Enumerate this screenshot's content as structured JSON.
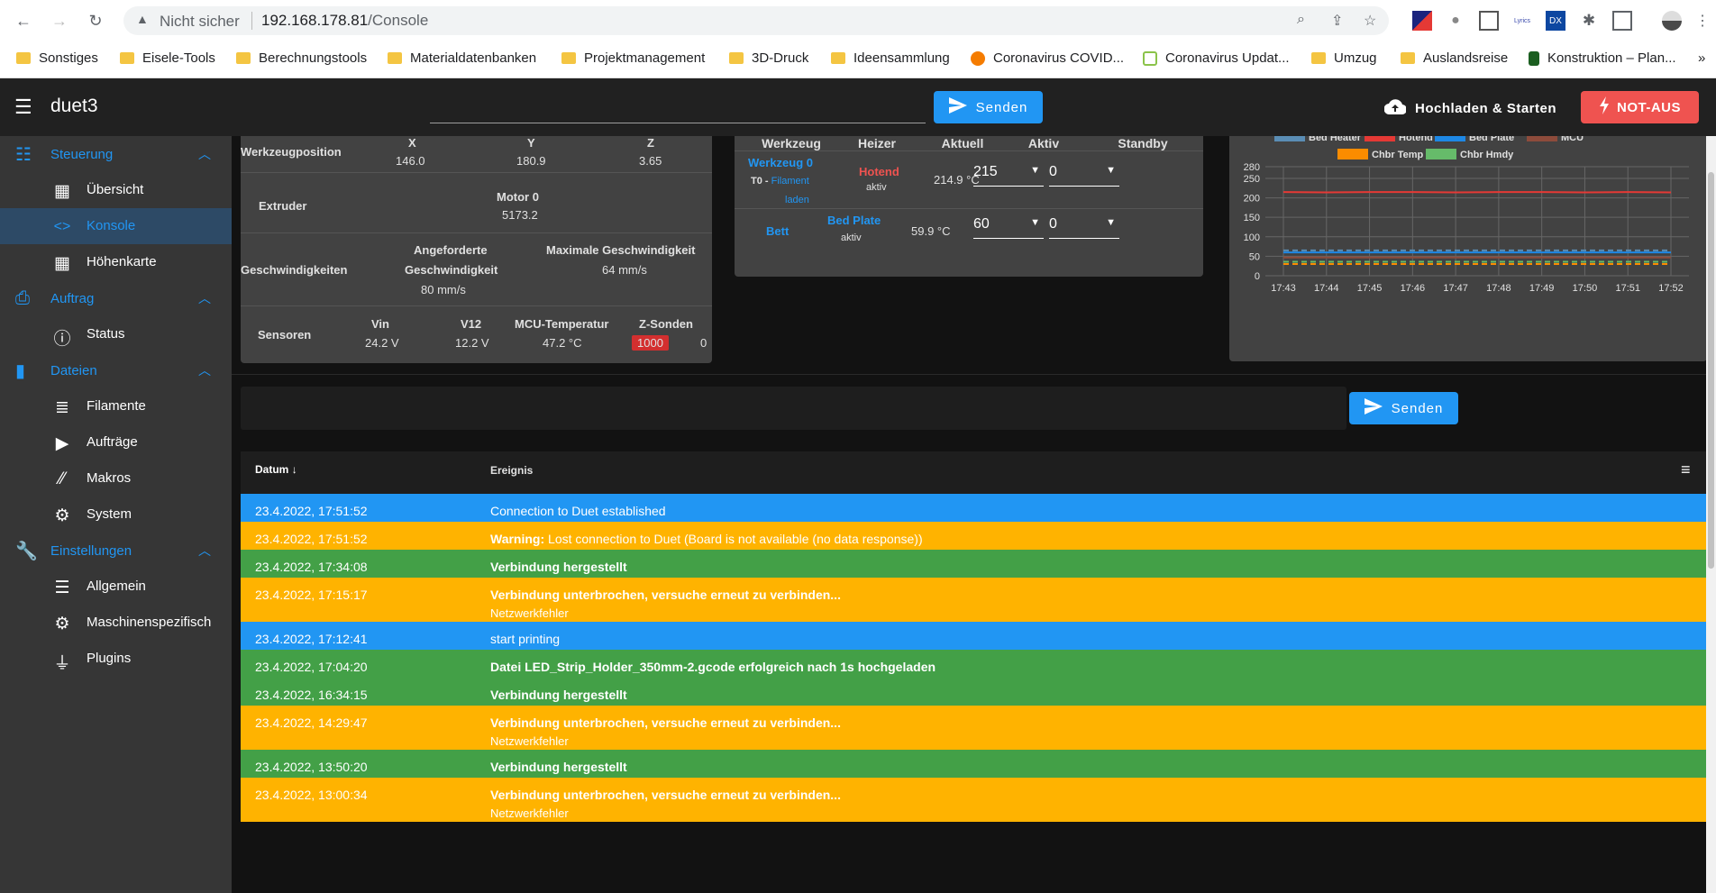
{
  "browser": {
    "security_label": "Nicht sicher",
    "url_host": "192.168.178.81",
    "url_path": "/Console",
    "bookmarks": [
      {
        "label": "Sonstiges",
        "kind": "folder"
      },
      {
        "label": "Eisele-Tools",
        "kind": "folder"
      },
      {
        "label": "Berechnungstools",
        "kind": "folder"
      },
      {
        "label": "Materialdatenbanken",
        "kind": "folder"
      },
      {
        "label": "Projektmanagement",
        "kind": "folder"
      },
      {
        "label": "3D-Druck",
        "kind": "folder"
      },
      {
        "label": "Ideensammlung",
        "kind": "folder"
      },
      {
        "label": "Coronavirus COVID...",
        "kind": "site"
      },
      {
        "label": "Coronavirus Updat...",
        "kind": "site"
      },
      {
        "label": "Umzug",
        "kind": "folder"
      },
      {
        "label": "Auslandsreise",
        "kind": "folder"
      },
      {
        "label": "Konstruktion – Plan...",
        "kind": "site"
      }
    ],
    "bookmarks_more": "»"
  },
  "app": {
    "title": "duet3",
    "send_label": "Senden",
    "upload_label": "Hochladen & Starten",
    "estop_label": "NOT-AUS"
  },
  "sidebar": {
    "groups": [
      {
        "label": "Steuerung",
        "icon": "sliders-icon",
        "items": [
          {
            "label": "Übersicht",
            "icon": "dashboard-icon",
            "active": false
          },
          {
            "label": "Konsole",
            "icon": "code-icon",
            "active": true
          },
          {
            "label": "Höhenkarte",
            "icon": "grid-icon",
            "active": false
          }
        ]
      },
      {
        "label": "Auftrag",
        "icon": "printer-icon",
        "items": [
          {
            "label": "Status",
            "icon": "info-icon",
            "active": false
          }
        ]
      },
      {
        "label": "Dateien",
        "icon": "sd-card-icon",
        "items": [
          {
            "label": "Filamente",
            "icon": "database-icon",
            "active": false
          },
          {
            "label": "Aufträge",
            "icon": "play-icon",
            "active": false
          },
          {
            "label": "Makros",
            "icon": "macro-icon",
            "active": false
          },
          {
            "label": "System",
            "icon": "gear-icon",
            "active": false
          }
        ]
      },
      {
        "label": "Einstellungen",
        "icon": "wrench-icon",
        "items": [
          {
            "label": "Allgemein",
            "icon": "tune-icon",
            "active": false
          },
          {
            "label": "Maschinenspezifisch",
            "icon": "cogs-icon",
            "active": false
          },
          {
            "label": "Plugins",
            "icon": "plug-icon",
            "active": false
          }
        ]
      }
    ]
  },
  "status": {
    "tool_position_label": "Werkzeugposition",
    "axes": [
      {
        "name": "X",
        "value": "146.0"
      },
      {
        "name": "Y",
        "value": "180.9"
      },
      {
        "name": "Z",
        "value": "3.65"
      }
    ],
    "extruder_label": "Extruder",
    "motor_label": "Motor 0",
    "motor_value": "5173.2",
    "speeds_label": "Geschwindigkeiten",
    "req_speed_label_1": "Angeforderte",
    "req_speed_label_2": "Geschwindigkeit",
    "req_speed_value": "80 mm/s",
    "max_speed_label": "Maximale Geschwindigkeit",
    "max_speed_value": "64 mm/s",
    "sensors_label": "Sensoren",
    "vin_label": "Vin",
    "vin_value": "24.2 V",
    "v12_label": "V12",
    "v12_value": "12.2 V",
    "mcu_label": "MCU-Temperatur",
    "mcu_value": "47.2 °C",
    "zprobe_label": "Z-Sonden",
    "zprobe_value_1": "1000",
    "zprobe_value_2": "0"
  },
  "tools": {
    "headers": [
      "Werkzeug",
      "Heizer",
      "Aktuell",
      "Aktiv",
      "Standby"
    ],
    "tool_name": "Werkzeug 0",
    "tool_sub_prefix": "T0 - ",
    "tool_sub_link_1": "Filament",
    "tool_sub_link_2": "laden",
    "heater_1_name": "Hotend",
    "heater_1_state": "aktiv",
    "heater_1_current": "214.9 °C",
    "heater_1_active": "215",
    "heater_1_standby": "0",
    "bed_label": "Bett",
    "heater_2_name": "Bed Plate",
    "heater_2_state": "aktiv",
    "heater_2_current": "59.9 °C",
    "heater_2_active": "60",
    "heater_2_standby": "0"
  },
  "colors": {
    "accent": "#2196f3",
    "warning": "#ffb300",
    "success": "#43a047",
    "danger": "#ef5350"
  },
  "chart_data": {
    "type": "line",
    "legend_row1": [
      "Bed Heater",
      "Hotend",
      "Bed Plate",
      "MCU"
    ],
    "legend_row2": [
      "Chbr Temp",
      "Chbr Hmdy"
    ],
    "x": [
      "17:43",
      "17:44",
      "17:45",
      "17:46",
      "17:47",
      "17:48",
      "17:49",
      "17:50",
      "17:51",
      "17:52"
    ],
    "yticks": [
      0,
      50,
      100,
      150,
      200,
      250,
      280
    ],
    "ylim": [
      0,
      280
    ],
    "series": [
      {
        "name": "Bed Heater",
        "color": "#5a8db5",
        "dashed": true,
        "values": [
          65,
          65,
          65,
          65,
          65,
          65,
          65,
          65,
          65,
          65
        ]
      },
      {
        "name": "Hotend",
        "color": "#e53935",
        "dashed": false,
        "values": [
          215,
          214,
          215,
          215,
          214,
          215,
          215,
          214,
          215,
          214
        ]
      },
      {
        "name": "Bed Plate",
        "color": "#1e88e5",
        "dashed": false,
        "values": [
          60,
          60,
          60,
          60,
          60,
          60,
          60,
          60,
          60,
          60
        ]
      },
      {
        "name": "MCU",
        "color": "#8d4b3b",
        "dashed": false,
        "values": [
          47,
          47,
          47,
          47,
          47,
          47,
          47,
          47,
          47,
          47
        ]
      },
      {
        "name": "Chbr Temp",
        "color": "#fb8c00",
        "dashed": true,
        "values": [
          30,
          30,
          30,
          30,
          30,
          30,
          30,
          30,
          30,
          30
        ]
      },
      {
        "name": "Chbr Hmdy",
        "color": "#66bb6a",
        "dashed": true,
        "values": [
          36,
          36,
          36,
          36,
          36,
          36,
          36,
          36,
          36,
          36
        ]
      }
    ]
  },
  "console": {
    "send_label": "Senden",
    "date_header": "Datum",
    "event_header": "Ereignis",
    "rows": [
      {
        "date": "23.4.2022, 17:51:52",
        "type": "blue",
        "bold_prefix": "",
        "message": "Connection to Duet established",
        "bold": false,
        "sub": ""
      },
      {
        "date": "23.4.2022, 17:51:52",
        "type": "orange",
        "bold_prefix": "Warning:",
        "message": " Lost connection to Duet (Board is not available (no data response))",
        "bold": false,
        "sub": ""
      },
      {
        "date": "23.4.2022, 17:34:08",
        "type": "green",
        "bold_prefix": "",
        "message": "Verbindung hergestellt",
        "bold": true,
        "sub": ""
      },
      {
        "date": "23.4.2022, 17:15:17",
        "type": "orange",
        "bold_prefix": "",
        "message": "Verbindung unterbrochen, versuche erneut zu verbinden...",
        "bold": true,
        "sub": "Netzwerkfehler"
      },
      {
        "date": "23.4.2022, 17:12:41",
        "type": "blue",
        "bold_prefix": "",
        "message": "start printing",
        "bold": false,
        "sub": ""
      },
      {
        "date": "23.4.2022, 17:04:20",
        "type": "green",
        "bold_prefix": "",
        "message": "Datei LED_Strip_Holder_350mm-2.gcode erfolgreich nach 1s hochgeladen",
        "bold": true,
        "sub": ""
      },
      {
        "date": "23.4.2022, 16:34:15",
        "type": "green",
        "bold_prefix": "",
        "message": "Verbindung hergestellt",
        "bold": true,
        "sub": ""
      },
      {
        "date": "23.4.2022, 14:29:47",
        "type": "orange",
        "bold_prefix": "",
        "message": "Verbindung unterbrochen, versuche erneut zu verbinden...",
        "bold": true,
        "sub": "Netzwerkfehler"
      },
      {
        "date": "23.4.2022, 13:50:20",
        "type": "green",
        "bold_prefix": "",
        "message": "Verbindung hergestellt",
        "bold": true,
        "sub": ""
      },
      {
        "date": "23.4.2022, 13:00:34",
        "type": "orange",
        "bold_prefix": "",
        "message": "Verbindung unterbrochen, versuche erneut zu verbinden...",
        "bold": true,
        "sub": "Netzwerkfehler"
      }
    ]
  }
}
